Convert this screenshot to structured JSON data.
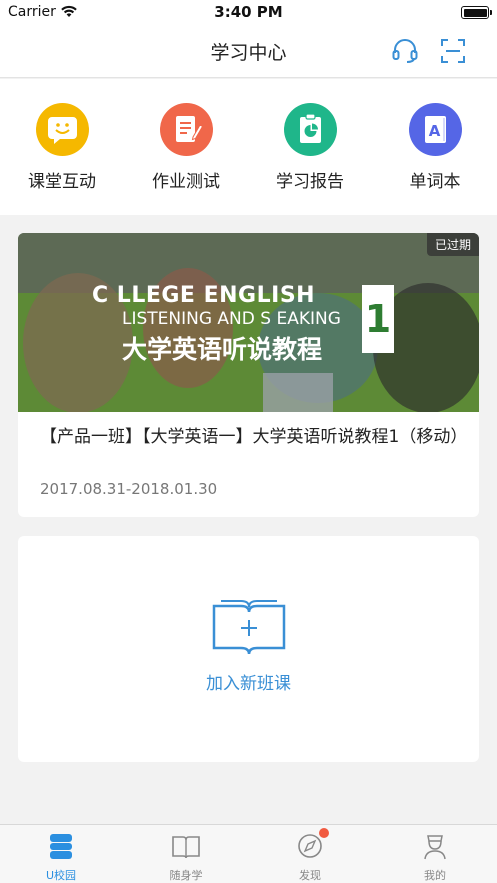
{
  "status": {
    "carrier": "Carrier",
    "time": "3:40 PM"
  },
  "nav": {
    "title": "学习中心"
  },
  "quick": [
    {
      "label": "课堂互动",
      "color": "#f5b800",
      "icon": "smiley-chat-icon"
    },
    {
      "label": "作业测试",
      "color": "#f0674a",
      "icon": "notepad-pen-icon"
    },
    {
      "label": "学习报告",
      "color": "#1fb68a",
      "icon": "report-chart-icon"
    },
    {
      "label": "单词本",
      "color": "#5566e6",
      "icon": "vocabulary-book-icon"
    }
  ],
  "course": {
    "tag": "已过期",
    "cover_en_line1": "C  LLEGE ENGLISH",
    "cover_en_line2": "LISTENING AND S  EAKING",
    "cover_cn": "大学英语听说教程",
    "cover_num": "1",
    "title": "【产品一班】【大学英语一】大学英语听说教程1（移动）",
    "date": "2017.08.31-2018.01.30"
  },
  "join": {
    "label": "加入新班课"
  },
  "tabs": [
    {
      "label": "U校园",
      "active": true
    },
    {
      "label": "随身学",
      "active": false
    },
    {
      "label": "发现",
      "active": false
    },
    {
      "label": "我的",
      "active": false
    }
  ],
  "colors": {
    "accent": "#2b8fe0",
    "link": "#3a8fd5",
    "badge": "#f15a40"
  }
}
